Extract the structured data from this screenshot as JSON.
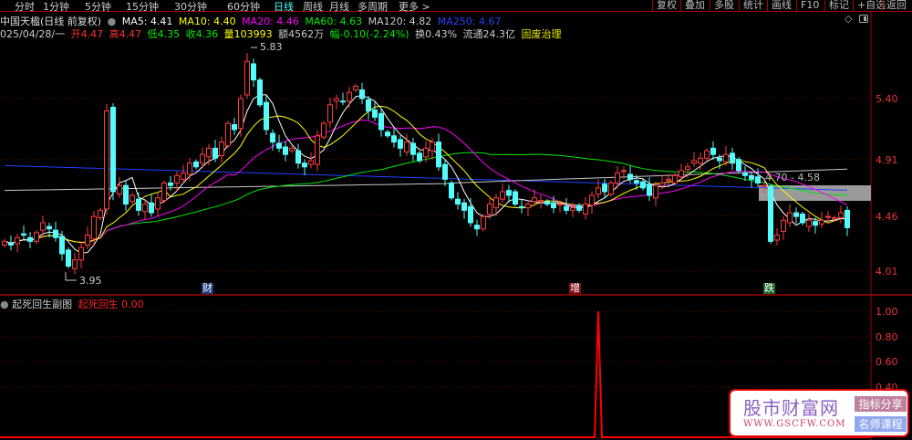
{
  "toolbar": {
    "left": [
      "分时",
      "1分钟",
      "5分钟",
      "15分钟",
      "30分钟",
      "60分钟",
      "日线",
      "周线",
      "月线",
      "多周期",
      "更多 >"
    ],
    "active": "日线",
    "right": [
      "复权",
      "叠加",
      "多股",
      "统计",
      "画线",
      "F10",
      "标记",
      "+自选",
      "返回"
    ]
  },
  "header": {
    "name": "中国天楹(日线 前复权)",
    "ma5": "MA5: 4.41",
    "ma10": "MA10: 4.40",
    "ma20": "MA20: 4.46",
    "ma60": "MA60: 4.63",
    "ma120": "MA120: 4.82",
    "ma250": "MA250: 4.67"
  },
  "quote": {
    "date": "025/04/28/一",
    "open": "开4.47",
    "high": "高4.47",
    "low": "低4.35",
    "close": "收4.36",
    "volume": "量103993",
    "amount": "额4562万",
    "change": "幅-0.10(-2.24%)",
    "turnover": "换0.43%",
    "float": "流通24.3亿",
    "concept": "固废治理"
  },
  "colors": {
    "up": "#ff3c3c",
    "down": "#54fcfc",
    "ma5": "#ffffff",
    "ma10": "#ffff00",
    "ma20": "#ff00ff",
    "ma60": "#00e600",
    "ma120": "#c8c8c8",
    "ma250": "#2040ff",
    "grid": "#a00000"
  },
  "price_axis": [
    "5.40",
    "4.91",
    "4.46",
    "4.01"
  ],
  "sub_axis": [
    "1.00",
    "0.80",
    "0.60",
    "0.40"
  ],
  "annotations": {
    "high": "5.83",
    "low": "3.95",
    "range": "4.70 - 4.58",
    "markers": [
      "财",
      "增",
      "跌"
    ]
  },
  "sub": {
    "title": "起死回生副图",
    "indicator": "起死回生",
    "value": "0.00"
  },
  "chart_data": {
    "type": "candlestick",
    "closes": [
      4.25,
      4.22,
      4.28,
      4.3,
      4.25,
      4.32,
      4.4,
      4.35,
      4.28,
      4.15,
      4.05,
      4.1,
      4.2,
      4.3,
      4.45,
      4.5,
      5.3,
      4.65,
      4.7,
      4.55,
      4.62,
      4.5,
      4.55,
      4.48,
      4.6,
      4.72,
      4.7,
      4.78,
      4.8,
      4.88,
      4.85,
      4.95,
      5.0,
      4.92,
      5.05,
      5.2,
      5.15,
      5.4,
      5.7,
      5.55,
      5.35,
      5.15,
      5.05,
      5.0,
      4.95,
      5.0,
      4.88,
      4.85,
      4.9,
      5.1,
      5.2,
      5.35,
      5.4,
      5.38,
      5.45,
      5.5,
      5.4,
      5.3,
      5.25,
      5.15,
      5.1,
      5.05,
      5.0,
      5.05,
      4.95,
      4.9,
      5.0,
      5.05,
      4.85,
      4.75,
      4.6,
      4.55,
      4.5,
      4.4,
      4.35,
      4.45,
      4.55,
      4.6,
      4.65,
      4.62,
      4.55,
      4.52,
      4.55,
      4.6,
      4.58,
      4.55,
      4.52,
      4.55,
      4.5,
      4.52,
      4.5,
      4.55,
      4.62,
      4.68,
      4.65,
      4.72,
      4.8,
      4.82,
      4.75,
      4.72,
      4.68,
      4.62,
      4.7,
      4.72,
      4.75,
      4.78,
      4.82,
      4.85,
      4.9,
      4.92,
      4.98,
      4.95,
      4.9,
      4.95,
      4.88,
      4.82,
      4.78,
      4.75,
      4.72,
      4.7,
      4.25,
      4.3,
      4.42,
      4.48,
      4.45,
      4.4,
      4.42,
      4.38,
      4.42,
      4.45,
      4.44,
      4.48,
      4.36
    ],
    "ylim": [
      4.01,
      5.4
    ],
    "sub_signal_index": 93,
    "sub_values_peak": 1.0
  }
}
